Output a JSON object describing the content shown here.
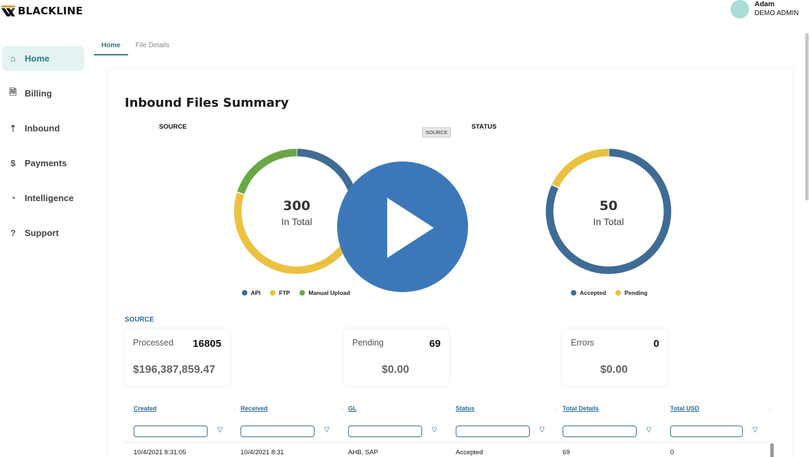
{
  "brand": {
    "name": "BLACKLINE"
  },
  "user": {
    "name": "Adam",
    "role": "DEMO ADMIN"
  },
  "sidebar": {
    "items": [
      {
        "label": "Home",
        "icon": "home-icon",
        "active": true
      },
      {
        "label": "Billing",
        "icon": "document-icon"
      },
      {
        "label": "Inbound",
        "icon": "cloud-upload-icon"
      },
      {
        "label": "Payments",
        "icon": "dollar-icon"
      },
      {
        "label": "Intelligence",
        "icon": "chart-icon"
      },
      {
        "label": "Support",
        "icon": "help-icon"
      }
    ]
  },
  "tabs": [
    {
      "label": "Home",
      "active": true
    },
    {
      "label": "File Details"
    }
  ],
  "summary": {
    "title": "Inbound Files Summary",
    "tooltip": "SOURCE",
    "source_chart": {
      "label": "SOURCE",
      "total": "300",
      "subtitle": "In Total"
    },
    "status_chart": {
      "label": "STATUS",
      "total": "50",
      "subtitle": "In Total"
    }
  },
  "colors": {
    "blue": "#3f6c94",
    "yellow": "#ecc13f",
    "green": "#6aa744",
    "teal": "#2b7c82",
    "play": "#3c78b9"
  },
  "chart_data": [
    {
      "type": "pie",
      "title": "SOURCE",
      "center_text": "300",
      "categories": [
        "API",
        "FTP",
        "Manual Upload"
      ],
      "values": [
        100,
        140,
        60
      ]
    },
    {
      "type": "pie",
      "title": "STATUS",
      "center_text": "50",
      "categories": [
        "Accepted",
        "Pending"
      ],
      "values": [
        41,
        9
      ]
    }
  ],
  "source_section": {
    "label": "SOURCE",
    "stats": [
      {
        "label": "Processed",
        "count": "16805",
        "amount": "$196,387,859.47"
      },
      {
        "label": "Pending",
        "count": "69",
        "amount": "$0.00"
      },
      {
        "label": "Errors",
        "count": "0",
        "amount": "$0.00"
      }
    ]
  },
  "table": {
    "columns": [
      "Created",
      "Received",
      "GL",
      "Status",
      "Total Details",
      "Total USD"
    ],
    "rows": [
      [
        "10/4/2021 8:31:05",
        "10/4/2021 8:31",
        "AHB, SAP",
        "Accepted",
        "69",
        "0"
      ]
    ]
  },
  "video": {
    "play_icon": "play-icon"
  }
}
